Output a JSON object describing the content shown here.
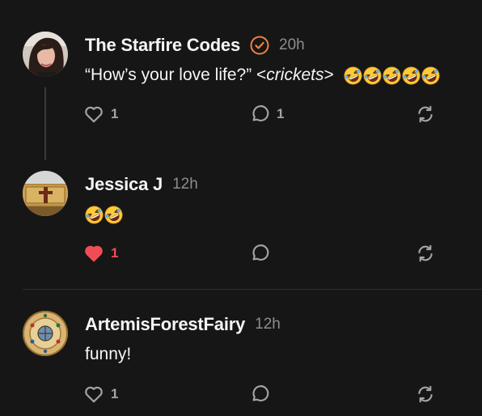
{
  "colors": {
    "background": "#161616",
    "verified": "#f2813c",
    "liked_heart": "#ef4d55",
    "muted": "#8d8d8d"
  },
  "comments": [
    {
      "author": "The Starfire Codes",
      "verified": true,
      "time": "20h",
      "text_pre": "“How’s your love life?” <",
      "text_em": "crickets",
      "text_post": ">",
      "emoji": [
        "rofl-emoji",
        "rofl-emoji",
        "rofl-emoji",
        "rofl-emoji",
        "rofl-emoji"
      ],
      "likes": "1",
      "liked": false,
      "replies": "1"
    },
    {
      "author": "Jessica J",
      "verified": false,
      "time": "12h",
      "emoji": [
        "rofl-emoji",
        "rofl-emoji"
      ],
      "likes": "1",
      "liked": true,
      "replies": ""
    },
    {
      "author": "ArtemisForestFairy",
      "verified": false,
      "time": "12h",
      "text": "funny!",
      "likes": "1",
      "liked": false,
      "replies": ""
    }
  ]
}
